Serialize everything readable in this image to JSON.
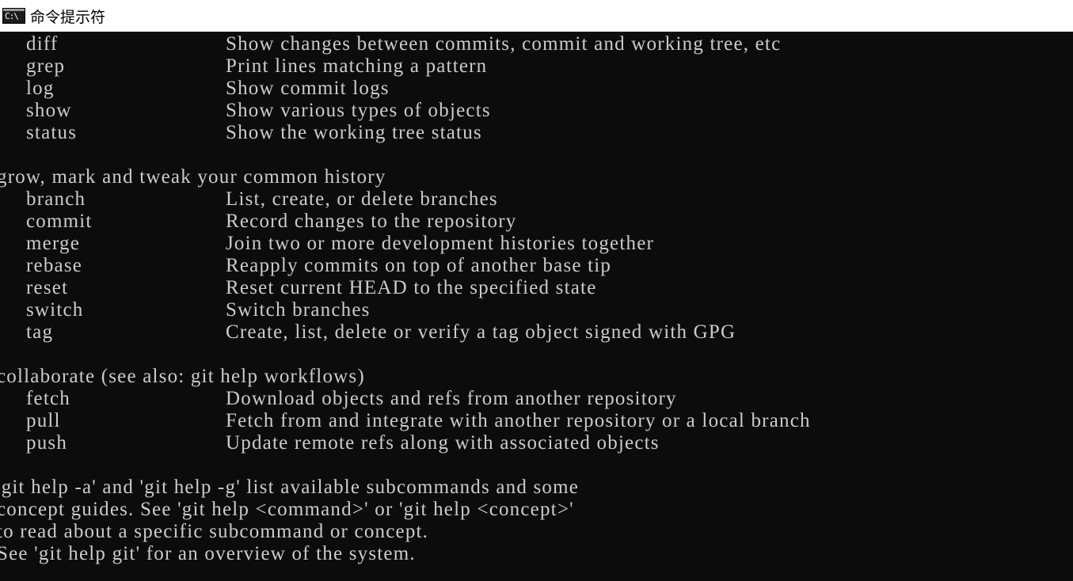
{
  "window": {
    "title": "命令提示符",
    "icon_text": "C:\\",
    "icon": "cmd-icon"
  },
  "colors": {
    "background": "#0c0c0c",
    "text": "#cccccc",
    "titlebar": "#ffffff"
  },
  "groups": [
    {
      "heading": "",
      "commands": [
        {
          "name": "diff",
          "desc": "Show changes between commits, commit and working tree, etc"
        },
        {
          "name": "grep",
          "desc": "Print lines matching a pattern"
        },
        {
          "name": "log",
          "desc": "Show commit logs"
        },
        {
          "name": "show",
          "desc": "Show various types of objects"
        },
        {
          "name": "status",
          "desc": "Show the working tree status"
        }
      ]
    },
    {
      "heading": "grow, mark and tweak your common history",
      "commands": [
        {
          "name": "branch",
          "desc": "List, create, or delete branches"
        },
        {
          "name": "commit",
          "desc": "Record changes to the repository"
        },
        {
          "name": "merge",
          "desc": "Join two or more development histories together"
        },
        {
          "name": "rebase",
          "desc": "Reapply commits on top of another base tip"
        },
        {
          "name": "reset",
          "desc": "Reset current HEAD to the specified state"
        },
        {
          "name": "switch",
          "desc": "Switch branches"
        },
        {
          "name": "tag",
          "desc": "Create, list, delete or verify a tag object signed with GPG"
        }
      ]
    },
    {
      "heading": "collaborate (see also: git help workflows)",
      "commands": [
        {
          "name": "fetch",
          "desc": "Download objects and refs from another repository"
        },
        {
          "name": "pull",
          "desc": "Fetch from and integrate with another repository or a local branch"
        },
        {
          "name": "push",
          "desc": "Update remote refs along with associated objects"
        }
      ]
    }
  ],
  "footer": [
    "'git help -a' and 'git help -g' list available subcommands and some",
    "concept guides. See 'git help <command>' or 'git help <concept>'",
    "to read about a specific subcommand or concept.",
    "See 'git help git' for an overview of the system."
  ]
}
